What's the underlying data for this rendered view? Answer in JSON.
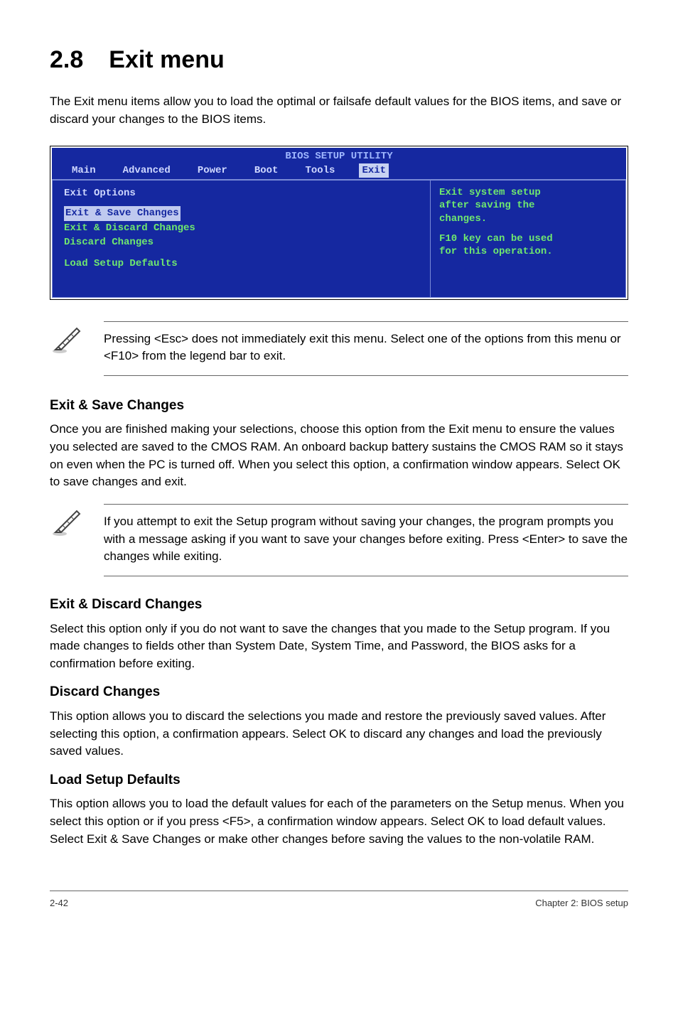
{
  "title": {
    "num": "2.8",
    "text": "Exit menu"
  },
  "intro": "The Exit menu items allow you to load the optimal or failsafe default values for the BIOS items, and save or discard your changes to the BIOS items.",
  "bios": {
    "utility_title": "BIOS SETUP UTILITY",
    "tabs": {
      "main": "Main",
      "advanced": "Advanced",
      "power": "Power",
      "boot": "Boot",
      "tools": "Tools",
      "exit": "Exit"
    },
    "left": {
      "heading": "Exit Options",
      "items": {
        "save": "Exit & Save Changes",
        "discard_exit": "Exit & Discard Changes",
        "discard": "Discard Changes",
        "defaults": "Load Setup Defaults"
      }
    },
    "right": {
      "l1": "Exit system setup",
      "l2": "after saving the",
      "l3": "changes.",
      "l4": "F10 key can be used",
      "l5": "for this operation."
    }
  },
  "note1": "Pressing <Esc> does not immediately exit this menu. Select one of the options from this menu or <F10> from the legend bar to exit.",
  "sections": {
    "exit_save": {
      "h": "Exit & Save Changes",
      "p": "Once you are finished making your selections, choose this option from the Exit menu to ensure the values you selected are saved to the CMOS RAM. An onboard backup battery sustains the CMOS RAM so it stays on even when the PC is turned off. When you select this option, a confirmation window appears. Select OK to save changes and exit."
    },
    "exit_discard": {
      "h": "Exit & Discard Changes",
      "p": "Select this option only if you do not want to save the changes that you  made to the Setup program. If you made changes to fields other than System Date, System Time, and Password, the BIOS asks for a confirmation before exiting."
    },
    "discard": {
      "h": "Discard Changes",
      "p": "This option allows you to discard the selections you made and restore the previously saved values. After selecting this option, a confirmation appears. Select OK to discard any changes and load the previously saved values."
    },
    "defaults": {
      "h": "Load Setup Defaults",
      "p": "This option allows you to load the default values for each of the parameters on the Setup menus. When you select this option or if you press <F5>, a confirmation window appears. Select OK to load default values. Select Exit & Save Changes or make other changes before saving the values to the non-volatile RAM."
    }
  },
  "note2": " If you attempt to exit the Setup program without saving your changes, the program prompts you with a message asking if you want to save your changes before exiting. Press <Enter>  to save the  changes while exiting.",
  "footer": {
    "left": "2-42",
    "right": "Chapter 2: BIOS setup"
  }
}
